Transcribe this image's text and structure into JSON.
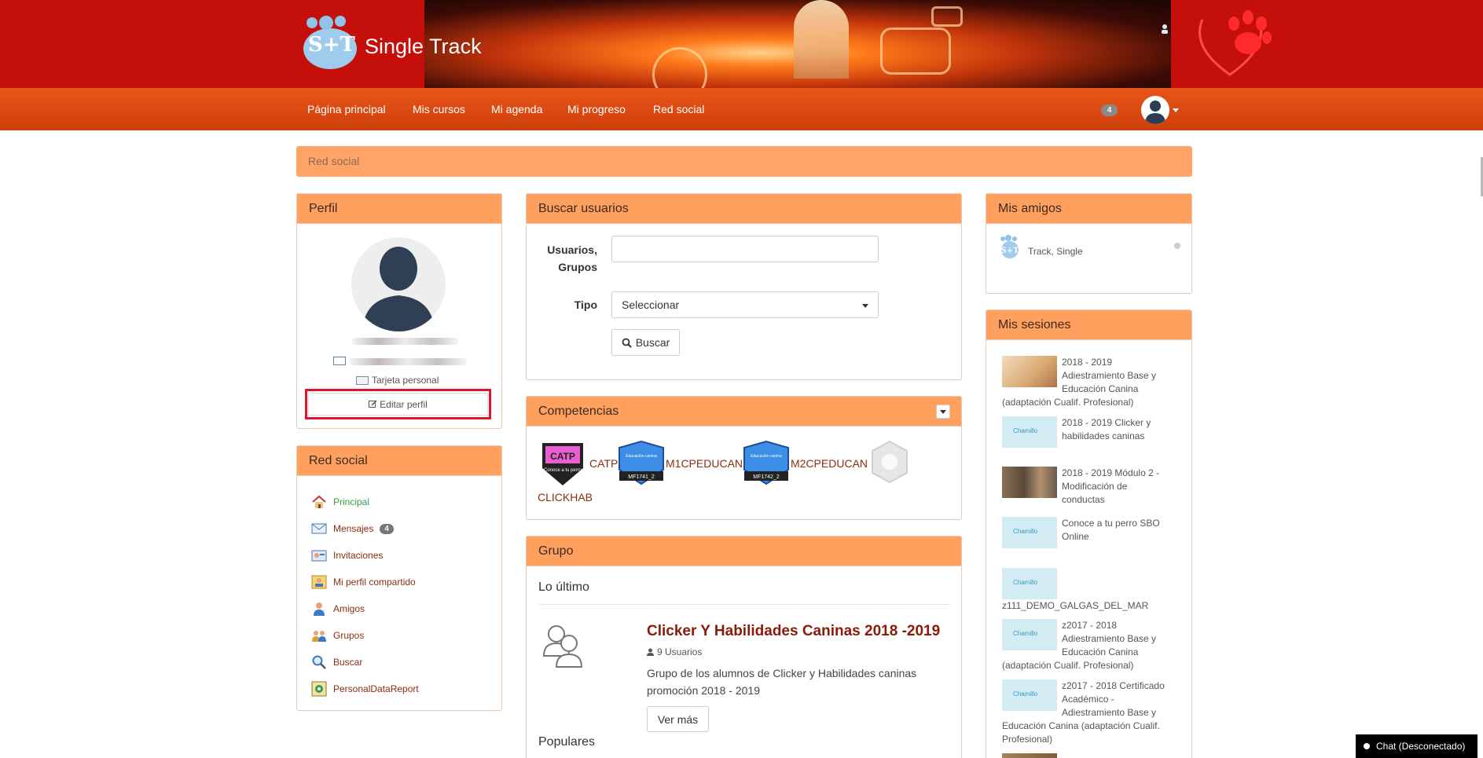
{
  "brand": {
    "name": "Single Track",
    "mark": "S+T"
  },
  "nav": {
    "items": [
      "Página principal",
      "Mis cursos",
      "Mi agenda",
      "Mi progreso",
      "Red social"
    ],
    "notification_count": "4"
  },
  "breadcrumb": "Red social",
  "profile": {
    "title": "Perfil",
    "card_link": "Tarjeta personal",
    "edit_button": "Editar perfil"
  },
  "social": {
    "title": "Red social",
    "items": [
      {
        "label": "Principal",
        "icon": "home-icon",
        "active": true
      },
      {
        "label": "Mensajes",
        "icon": "mail-icon",
        "badge": "4"
      },
      {
        "label": "Invitaciones",
        "icon": "invitation-icon"
      },
      {
        "label": "Mi perfil compartido",
        "icon": "shared-profile-icon"
      },
      {
        "label": "Amigos",
        "icon": "friends-icon"
      },
      {
        "label": "Grupos",
        "icon": "groups-icon"
      },
      {
        "label": "Buscar",
        "icon": "search-icon"
      },
      {
        "label": "PersonalDataReport",
        "icon": "report-icon"
      }
    ]
  },
  "search": {
    "title": "Buscar usuarios",
    "users_label_1": "Usuarios,",
    "users_label_2": "Grupos",
    "type_label": "Tipo",
    "type_value": "Seleccionar",
    "button": "Buscar"
  },
  "competencias": {
    "title": "Competencias",
    "items": [
      {
        "label": "CATP",
        "badge_text": "CATP",
        "badge_sub": "Conoce a tu perro",
        "color": "#ea5fd0"
      },
      {
        "label": "M1CPEDUCAN",
        "badge_text": "Educación canina",
        "badge_sub": "MF1741_2",
        "color": "#3d8ee6"
      },
      {
        "label": "M2CPEDUCAN",
        "badge_text": "Educación canina",
        "badge_sub": "MF1742_2",
        "color": "#3d8ee6"
      },
      {
        "label": "CLICKHAB"
      }
    ]
  },
  "grupo": {
    "title": "Grupo",
    "latest": "Lo último",
    "group_name": "Clicker Y Habilidades Caninas 2018 -2019",
    "members": "9 Usuarios",
    "description_1": "Grupo de los alumnos de Clicker y Habilidades caninas",
    "description_2": "promoción 2018 - 2019",
    "more_button": "Ver más",
    "popular": "Populares"
  },
  "friends": {
    "title": "Mis amigos",
    "items": [
      {
        "name": "Track, Single"
      }
    ]
  },
  "sessions": {
    "title": "Mis sesiones",
    "items": [
      {
        "lines": [
          "2018 - 2019",
          "Adiestramiento Base y",
          "Educación Canina"
        ],
        "tail": "(adaptación Cualif. Profesional)",
        "thumb": "dog"
      },
      {
        "lines": [
          "2018 - 2019 Clicker y",
          "habilidades caninas"
        ],
        "thumb": "logo"
      },
      {
        "lines": [
          "2018 - 2019 Módulo 2 -",
          "Modificación de",
          "conductas"
        ],
        "thumb": "dogs"
      },
      {
        "lines": [
          "Conoce a tu perro SBO",
          "Online"
        ],
        "thumb": "logo"
      },
      {
        "lines": [],
        "tail": "z111_DEMO_GALGAS_DEL_MAR",
        "thumb": "logo"
      },
      {
        "lines": [
          "z2017 - 2018",
          "Adiestramiento Base y",
          "Educación Canina"
        ],
        "tail": "(adaptación Cualif. Profesional)",
        "thumb": "logo"
      },
      {
        "lines": [
          "z2017 - 2018 Certificado",
          "Académico -",
          "Adiestramiento Base y"
        ],
        "tail": "Educación Canina (adaptación Cualif.",
        "tail2": "Profesional)",
        "thumb": "logo"
      }
    ],
    "thumb_logo_text": "Chamillo"
  },
  "chat": {
    "label": "Chat (Desconectado)"
  },
  "colors": {
    "brand_red": "#c40f0a",
    "nav_orange": "#e0501a",
    "panel_orange": "#ffa05f",
    "link": "#8a2d12",
    "active_link": "#3a9a4a"
  }
}
